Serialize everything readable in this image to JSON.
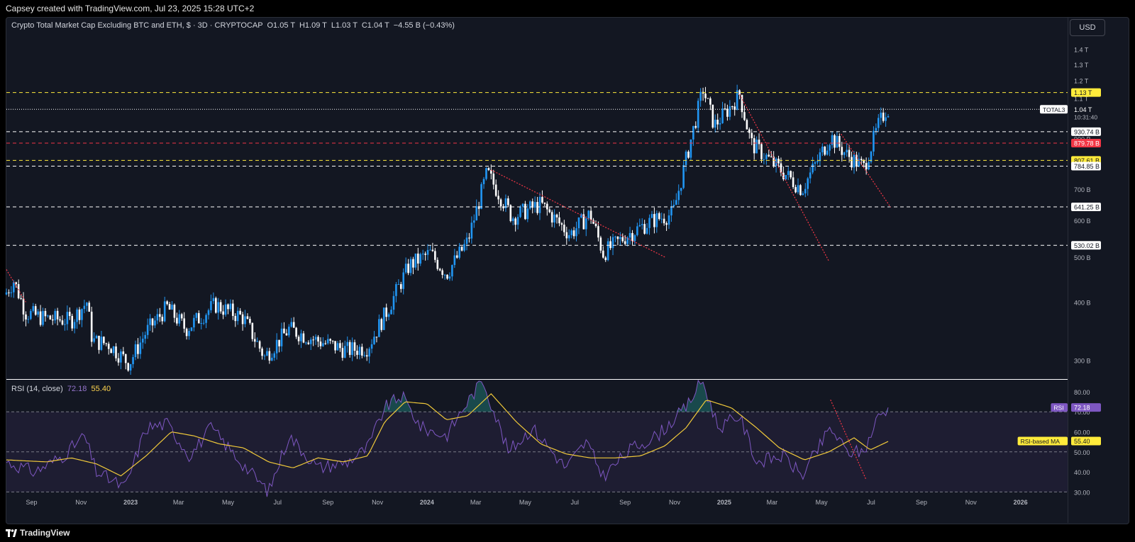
{
  "header": {
    "caption": "Capsey created with TradingView.com, Jul 23, 2025 15:28 UTC+2"
  },
  "legend": {
    "title": "Crypto Total Market Cap Excluding BTC and ETH, $ · 3D · CRYPTOCAP",
    "open": "O1.05 T",
    "high": "H1.09 T",
    "low": "L1.03 T",
    "close": "C1.04 T",
    "change": "−4.55 B (−0.43%)"
  },
  "currency_button": "USD",
  "rsi_legend": {
    "label": "RSI (14, close)",
    "rsi_value": "72.18",
    "ma_value": "55.40"
  },
  "footer": {
    "brand": "TradingView"
  },
  "colors": {
    "background": "#131722",
    "candle_up": "#2196f3",
    "candle_down": "#ffffff",
    "level_white": "#ffffff",
    "level_yellow": "#ffeb3b",
    "level_red": "#f23645",
    "rsi_line": "#7e57c2",
    "rsi_ma": "#f0c93a"
  },
  "chart_data": [
    {
      "type": "candlestick",
      "title": "Crypto Total Market Cap Excluding BTC and ETH, $ · 3D · CRYPTOCAP",
      "y_scale": "log",
      "ylim": [
        280,
        1500
      ],
      "y_unit": "B USD",
      "y_ticks": [
        "1.4 T",
        "1.3 T",
        "1.2 T",
        "1.1 T",
        "1 T",
        "900 B",
        "800 B",
        "700 B",
        "600 B",
        "500 B",
        "400 B",
        "300 B"
      ],
      "x_ticks": [
        "Sep",
        "Nov",
        "2023",
        "Mar",
        "May",
        "Jul",
        "Sep",
        "Nov",
        "2024",
        "Mar",
        "May",
        "Jul",
        "Sep",
        "Nov",
        "2025",
        "Mar",
        "May",
        "Jul",
        "Sep",
        "Nov",
        "2026"
      ],
      "x_range": [
        "2022-08-01",
        "2026-02-28"
      ],
      "path": [
        [
          "2022-08-01",
          420
        ],
        [
          "2022-08-10",
          445
        ],
        [
          "2022-08-25",
          380
        ],
        [
          "2022-09-15",
          370
        ],
        [
          "2022-10-20",
          365
        ],
        [
          "2022-11-08",
          400
        ],
        [
          "2022-11-15",
          330
        ],
        [
          "2022-12-05",
          325
        ],
        [
          "2022-12-30",
          295
        ],
        [
          "2023-01-20",
          345
        ],
        [
          "2023-02-15",
          390
        ],
        [
          "2023-03-10",
          350
        ],
        [
          "2023-04-15",
          395
        ],
        [
          "2023-05-20",
          370
        ],
        [
          "2023-06-15",
          305
        ],
        [
          "2023-07-15",
          350
        ],
        [
          "2023-08-20",
          330
        ],
        [
          "2023-09-25",
          315
        ],
        [
          "2023-10-20",
          320
        ],
        [
          "2023-11-15",
          390
        ],
        [
          "2023-12-10",
          480
        ],
        [
          "2024-01-05",
          510
        ],
        [
          "2024-01-25",
          460
        ],
        [
          "2024-02-20",
          540
        ],
        [
          "2024-03-15",
          760
        ],
        [
          "2024-04-15",
          610
        ],
        [
          "2024-05-20",
          650
        ],
        [
          "2024-06-25",
          560
        ],
        [
          "2024-07-20",
          620
        ],
        [
          "2024-08-05",
          510
        ],
        [
          "2024-09-05",
          560
        ],
        [
          "2024-10-05",
          600
        ],
        [
          "2024-10-30",
          620
        ],
        [
          "2024-11-20",
          880
        ],
        [
          "2024-12-06",
          1150
        ],
        [
          "2024-12-20",
          960
        ],
        [
          "2025-01-06",
          1040
        ],
        [
          "2025-01-20",
          1120
        ],
        [
          "2025-02-03",
          880
        ],
        [
          "2025-03-01",
          800
        ],
        [
          "2025-04-07",
          700
        ],
        [
          "2025-05-12",
          910
        ],
        [
          "2025-06-01",
          830
        ],
        [
          "2025-06-22",
          780
        ],
        [
          "2025-07-10",
          960
        ],
        [
          "2025-07-20",
          1045
        ],
        [
          "2025-07-23",
          1040
        ]
      ],
      "horizontal_levels": [
        {
          "label": "1.13 T",
          "value": 1130,
          "color": "yellow"
        },
        {
          "label": "930.74 B",
          "value": 930.74,
          "color": "white"
        },
        {
          "label": "879.78 B",
          "value": 879.78,
          "color": "red"
        },
        {
          "label": "807.61 B",
          "value": 807.61,
          "color": "yellow"
        },
        {
          "label": "784.85 B",
          "value": 784.85,
          "color": "white"
        },
        {
          "label": "641.25 B",
          "value": 641.25,
          "color": "white"
        },
        {
          "label": "530.02 B",
          "value": 530.02,
          "color": "white"
        }
      ],
      "last_price": {
        "label": "TOTAL3",
        "value": "1.04 T",
        "countdown": "10:31:40"
      },
      "trendlines": [
        {
          "from": [
            "2024-03-20",
            770
          ],
          "to": [
            "2024-10-20",
            500
          ]
        },
        {
          "from": [
            "2025-01-20",
            1120
          ],
          "to": [
            "2025-05-10",
            490
          ]
        },
        {
          "from": [
            "2025-05-25",
            920
          ],
          "to": [
            "2025-07-25",
            640
          ]
        },
        {
          "from": [
            "2022-08-01",
            470
          ],
          "to": [
            "2022-08-25",
            400
          ]
        }
      ]
    },
    {
      "type": "line",
      "title": "RSI (14, close)",
      "ylim": [
        28,
        86
      ],
      "y_ticks": [
        "80.00",
        "70.00",
        "60.00",
        "50.00",
        "40.00",
        "30.00"
      ],
      "bands": {
        "upper": 70,
        "middle": 50,
        "lower": 30
      },
      "series": [
        {
          "name": "RSI",
          "last": 72.18,
          "color": "#7e57c2",
          "path": [
            [
              "2022-08-01",
              45
            ],
            [
              "2022-09-05",
              40
            ],
            [
              "2022-10-10",
              48
            ],
            [
              "2022-11-05",
              58
            ],
            [
              "2022-11-20",
              40
            ],
            [
              "2022-12-25",
              32
            ],
            [
              "2023-01-20",
              62
            ],
            [
              "2023-02-15",
              64
            ],
            [
              "2023-03-15",
              48
            ],
            [
              "2023-04-10",
              62
            ],
            [
              "2023-05-10",
              48
            ],
            [
              "2023-06-20",
              30
            ],
            [
              "2023-07-15",
              58
            ],
            [
              "2023-08-20",
              42
            ],
            [
              "2023-09-25",
              45
            ],
            [
              "2023-10-20",
              52
            ],
            [
              "2023-11-10",
              72
            ],
            [
              "2023-12-01",
              78
            ],
            [
              "2023-12-25",
              62
            ],
            [
              "2024-01-25",
              58
            ],
            [
              "2024-02-15",
              72
            ],
            [
              "2024-03-10",
              86
            ],
            [
              "2024-04-10",
              50
            ],
            [
              "2024-05-10",
              62
            ],
            [
              "2024-06-20",
              42
            ],
            [
              "2024-07-15",
              55
            ],
            [
              "2024-08-05",
              38
            ],
            [
              "2024-09-10",
              52
            ],
            [
              "2024-10-10",
              58
            ],
            [
              "2024-11-15",
              72
            ],
            [
              "2024-12-05",
              86
            ],
            [
              "2024-12-25",
              62
            ],
            [
              "2025-01-20",
              68
            ],
            [
              "2025-02-10",
              45
            ],
            [
              "2025-03-15",
              48
            ],
            [
              "2025-04-07",
              38
            ],
            [
              "2025-05-12",
              62
            ],
            [
              "2025-06-01",
              50
            ],
            [
              "2025-06-22",
              50
            ],
            [
              "2025-07-10",
              68
            ],
            [
              "2025-07-23",
              72.18
            ]
          ]
        },
        {
          "name": "RSI-based MA",
          "last": 55.4,
          "color": "#f0c93a",
          "path": [
            [
              "2022-08-01",
              46
            ],
            [
              "2022-09-20",
              45
            ],
            [
              "2022-10-20",
              47
            ],
            [
              "2022-11-20",
              44
            ],
            [
              "2022-12-20",
              38
            ],
            [
              "2023-01-20",
              48
            ],
            [
              "2023-02-20",
              60
            ],
            [
              "2023-03-20",
              58
            ],
            [
              "2023-04-20",
              54
            ],
            [
              "2023-05-20",
              52
            ],
            [
              "2023-06-20",
              45
            ],
            [
              "2023-07-20",
              42
            ],
            [
              "2023-08-20",
              47
            ],
            [
              "2023-09-20",
              45
            ],
            [
              "2023-10-20",
              48
            ],
            [
              "2023-11-10",
              65
            ],
            [
              "2023-12-05",
              75
            ],
            [
              "2024-01-01",
              74
            ],
            [
              "2024-01-25",
              66
            ],
            [
              "2024-02-20",
              68
            ],
            [
              "2024-03-20",
              79
            ],
            [
              "2024-04-20",
              65
            ],
            [
              "2024-05-20",
              54
            ],
            [
              "2024-06-20",
              49
            ],
            [
              "2024-07-20",
              47
            ],
            [
              "2024-08-20",
              47
            ],
            [
              "2024-09-20",
              48
            ],
            [
              "2024-10-20",
              53
            ],
            [
              "2024-11-15",
              62
            ],
            [
              "2024-12-10",
              76
            ],
            [
              "2025-01-10",
              72
            ],
            [
              "2025-02-10",
              62
            ],
            [
              "2025-03-10",
              52
            ],
            [
              "2025-04-10",
              46
            ],
            [
              "2025-05-10",
              50
            ],
            [
              "2025-06-10",
              57
            ],
            [
              "2025-06-30",
              51
            ],
            [
              "2025-07-23",
              55.4
            ]
          ]
        }
      ],
      "markers": [
        {
          "label": "RSI",
          "value": "72.18"
        },
        {
          "label": "RSI-based MA",
          "value": "55.40"
        }
      ]
    }
  ]
}
